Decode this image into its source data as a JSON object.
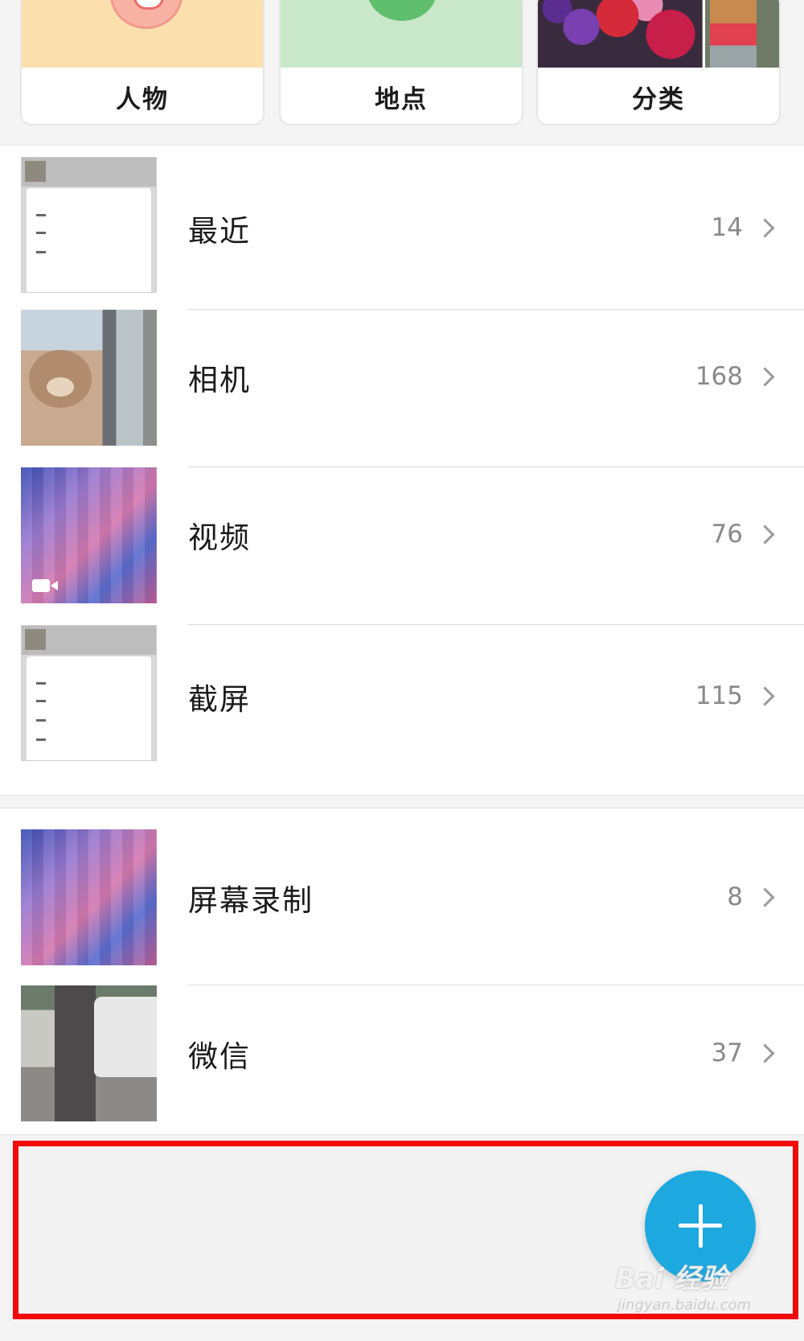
{
  "categories": [
    {
      "label": "人物",
      "icon": "person-face-icon"
    },
    {
      "label": "地点",
      "icon": "location-pin-icon"
    },
    {
      "label": "分类",
      "icon": "flowers-photo"
    }
  ],
  "albums_primary": [
    {
      "title": "最近",
      "count": "14"
    },
    {
      "title": "相机",
      "count": "168"
    },
    {
      "title": "视频",
      "count": "76"
    },
    {
      "title": "截屏",
      "count": "115"
    }
  ],
  "albums_secondary": [
    {
      "title": "屏幕录制",
      "count": "8"
    },
    {
      "title": "微信",
      "count": "37"
    }
  ],
  "fab": {
    "icon": "plus-icon",
    "color": "#1ea8e0"
  },
  "watermark": {
    "brand": "Bai  经验",
    "site": "jingyan.baidu.com"
  },
  "highlight_color": "#f00a0a"
}
